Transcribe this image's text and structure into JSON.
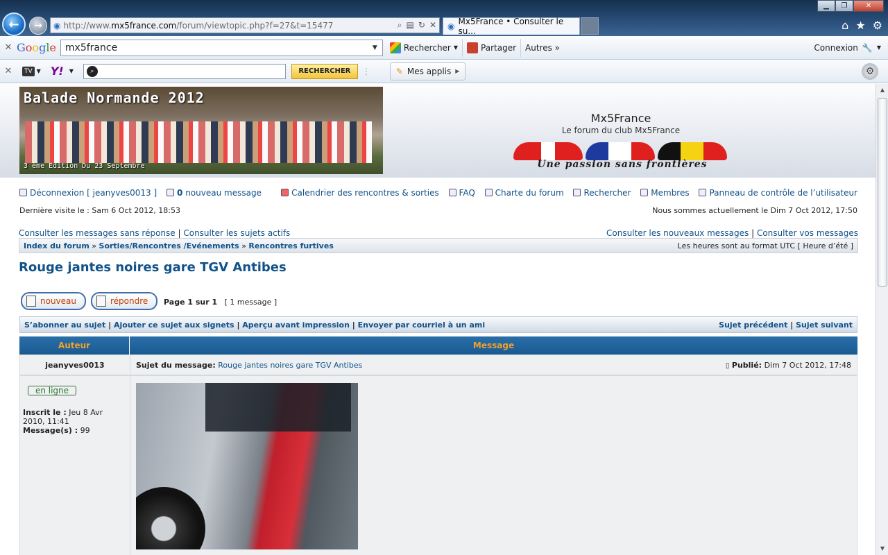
{
  "browser": {
    "url_prefix": "http://www.",
    "url_domain": "mx5france.com",
    "url_path": "/forum/viewtopic.php?f=27&t=15477",
    "tab_title": "Mx5France • Consulter le su..."
  },
  "google_bar": {
    "logo": "Google",
    "query": "mx5france",
    "search_label": "Rechercher",
    "share_label": "Partager",
    "more_label": "Autres »",
    "login_label": "Connexion"
  },
  "yahoo_bar": {
    "tv_label": "TV",
    "yahoo_logo": "Y!",
    "search_btn": "RECHERCHER",
    "apps_label": "Mes applis"
  },
  "header": {
    "banner_title": "Balade Normande 2012",
    "banner_sub": "3 ème Edition Du 23 Septembre",
    "site_name": "Mx5France",
    "site_desc": "Le forum du club Mx5France",
    "slogan": "Une passion sans frontières"
  },
  "userbar": {
    "logout": "Déconnexion [ jeanyves0013 ]",
    "new_msg_count": "0",
    "new_msg_label": "nouveau message",
    "calendar": "Calendrier des rencontres & sorties",
    "faq": "FAQ",
    "charter": "Charte du forum",
    "search": "Rechercher",
    "members": "Membres",
    "ucp": "Panneau de contrôle de l’utilisateur",
    "last_visit": "Dernière visite le : Sam 6 Oct 2012, 18:53",
    "now": "Nous sommes actuellement le Dim 7 Oct 2012, 17:50"
  },
  "quicklinks": {
    "unanswered": "Consulter les messages sans réponse",
    "active": "Consulter les sujets actifs",
    "new_posts": "Consulter les nouveaux messages",
    "your_posts": "Consulter vos messages"
  },
  "breadcrumb": {
    "index": "Index du forum",
    "sep": "»",
    "cat": "Sorties/Rencontres /Evénements",
    "forum": "Rencontres furtives",
    "tz": "Les heures sont au format UTC [ Heure d’été ]"
  },
  "topic": {
    "title": "Rouge jantes noires gare TGV Antibes",
    "new_btn": "nouveau",
    "reply_btn": "répondre",
    "page": "Page 1 sur 1",
    "count": "[ 1 message ]"
  },
  "actions": {
    "subscribe": "S’abonner au sujet",
    "bookmark": "Ajouter ce sujet aux signets",
    "print": "Aperçu avant impression",
    "email": "Envoyer par courriel à un ami",
    "prev": "Sujet précédent",
    "next": "Sujet suivant"
  },
  "table": {
    "col_author": "Auteur",
    "col_message": "Message"
  },
  "post": {
    "author": "jeanyves0013",
    "subject_label": "Sujet du message:",
    "subject": "Rouge jantes noires gare TGV Antibes",
    "posted_label": "Publié:",
    "posted": "Dim 7 Oct 2012, 17:48",
    "online": "en ligne",
    "joined_label": "Inscrit le :",
    "joined": "Jeu 8 Avr 2010, 11:41",
    "posts_label": "Message(s) :",
    "posts": "99"
  },
  "colors": {
    "link": "#105289",
    "header_blue": "#1a5a92",
    "header_text": "#f0a22a"
  }
}
